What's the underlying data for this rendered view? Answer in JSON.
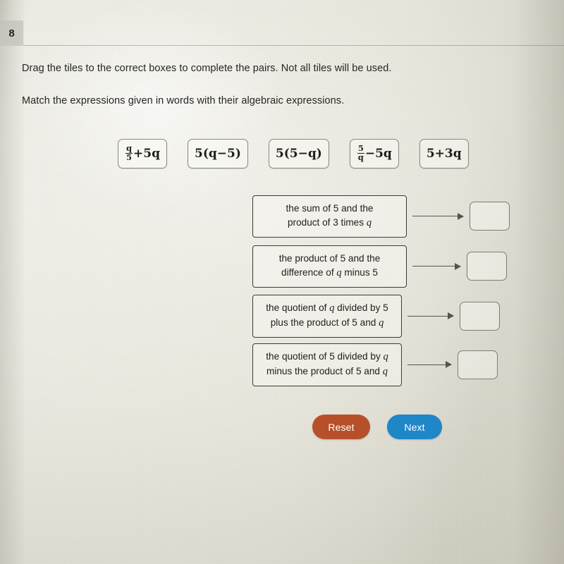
{
  "question": {
    "number": "8",
    "instructions": [
      "Drag the tiles to the correct boxes to complete the pairs. Not all tiles will be used.",
      "Match the expressions given in words with their algebraic expressions."
    ]
  },
  "tiles": [
    {
      "id": "tile-1",
      "text": "q/5+5q",
      "parts": [
        {
          "type": "fraction",
          "num": "q",
          "den": "5"
        },
        {
          "type": "text",
          "value": "+5"
        },
        {
          "type": "italic",
          "value": "q"
        }
      ]
    },
    {
      "id": "tile-2",
      "text": "5(q-5)",
      "parts": [
        {
          "type": "text",
          "value": "5("
        },
        {
          "type": "italic",
          "value": "q"
        },
        {
          "type": "text",
          "value": "−5)"
        }
      ]
    },
    {
      "id": "tile-3",
      "text": "5(5-q)",
      "parts": [
        {
          "type": "text",
          "value": "5(5−"
        },
        {
          "type": "italic",
          "value": "q"
        },
        {
          "type": "text",
          "value": ")"
        }
      ]
    },
    {
      "id": "tile-4",
      "text": "5/q-5q",
      "parts": [
        {
          "type": "fraction",
          "num": "5",
          "den": "q"
        },
        {
          "type": "text",
          "value": "−5"
        },
        {
          "type": "italic",
          "value": "q"
        }
      ]
    },
    {
      "id": "tile-5",
      "text": "5+3q",
      "parts": [
        {
          "type": "text",
          "value": "5+3"
        },
        {
          "type": "italic",
          "value": "q"
        }
      ]
    }
  ],
  "match_rows": [
    {
      "id": "row-1",
      "lines": [
        "the sum of 5 and the",
        "product of 3 times q"
      ],
      "dropbox_value": ""
    },
    {
      "id": "row-2",
      "lines": [
        "the product of 5 and the",
        "difference of q minus 5"
      ],
      "dropbox_value": ""
    },
    {
      "id": "row-3",
      "lines": [
        "the quotient of q divided by 5",
        "plus the product of 5 and q"
      ],
      "dropbox_value": ""
    },
    {
      "id": "row-4",
      "lines": [
        "the quotient of 5 divided by q",
        "minus the product of 5 and q"
      ],
      "dropbox_value": ""
    }
  ],
  "buttons": {
    "reset_label": "Reset",
    "next_label": "Next"
  },
  "colors": {
    "reset_button": "#b7502a",
    "next_button": "#1f86c8",
    "page_background": "#ecebe2",
    "text": "#262626"
  }
}
